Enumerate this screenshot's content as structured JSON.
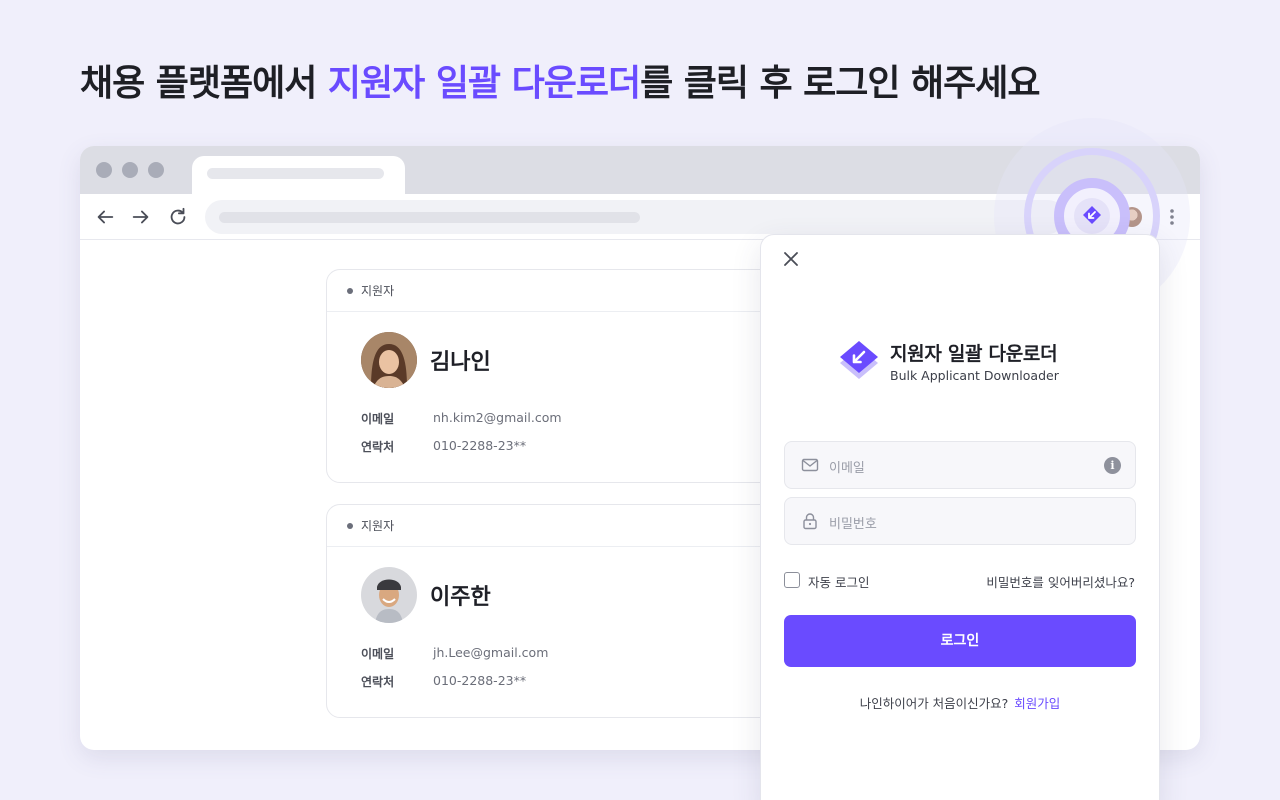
{
  "headline": {
    "before": "채용 플랫폼에서 ",
    "accent": "지원자 일괄 다운로더",
    "after": "를 클릭 후 로그인 해주세요"
  },
  "colors": {
    "accent": "#6a4bff",
    "background": "#f0effb"
  },
  "browser": {
    "icons": [
      "back-arrow-icon",
      "forward-arrow-icon",
      "reload-icon",
      "extension-icon",
      "profile-avatar",
      "more-vert-icon"
    ]
  },
  "cards": [
    {
      "tag": "지원자",
      "name": "김나인",
      "email_label": "이메일",
      "email": "nh.kim2@gmail.com",
      "phone_label": "연락처",
      "phone": "010-2288-23**"
    },
    {
      "tag": "지원자",
      "name": "이주한",
      "email_label": "이메일",
      "email": "jh.Lee@gmail.com",
      "phone_label": "연락처",
      "phone": "010-2288-23**"
    }
  ],
  "popup": {
    "brand_ko": "지원자 일괄 다운로더",
    "brand_en": "Bulk Applicant Downloader",
    "email_placeholder": "이메일",
    "password_placeholder": "비밀번호",
    "auto_login_label": "자동 로그인",
    "forgot_password": "비밀번호를 잊어버리셨나요?",
    "login_button": "로그인",
    "signup_prompt": "나인하이어가 처음이신가요?",
    "signup_link": "회원가입"
  }
}
